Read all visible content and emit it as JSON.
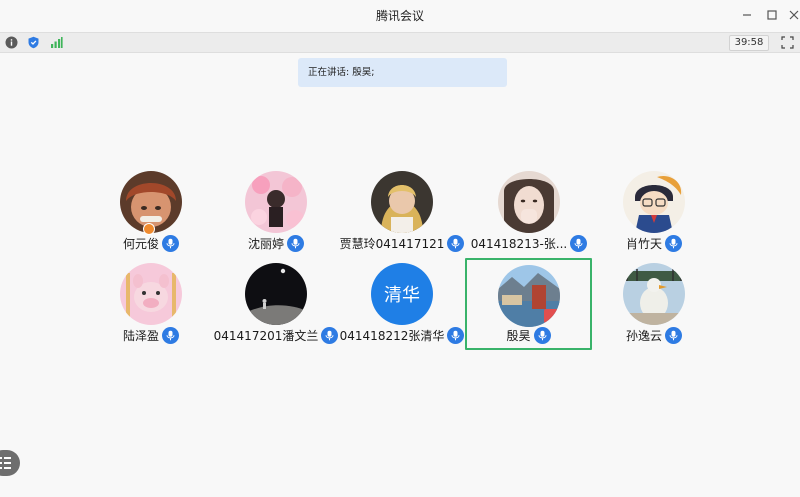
{
  "window": {
    "title": "腾讯会议"
  },
  "toolbar": {
    "timer": "39:58"
  },
  "speaking": {
    "text": "正在讲话: 殷昊;"
  },
  "participants": [
    {
      "name": "何元俊",
      "host": true,
      "active": false
    },
    {
      "name": "沈丽婷",
      "host": false,
      "active": false
    },
    {
      "name": "贾慧玲041417121",
      "host": false,
      "active": false
    },
    {
      "name": "041418213-张...",
      "host": false,
      "active": false
    },
    {
      "name": "肖竹天",
      "host": false,
      "active": false
    },
    {
      "name": "陆泽盈",
      "host": false,
      "active": false
    },
    {
      "name": "041417201潘文兰",
      "host": false,
      "active": false
    },
    {
      "name": "041418212张清华",
      "host": false,
      "active": false,
      "avatar_text": "清华"
    },
    {
      "name": "殷昊",
      "host": false,
      "active": true
    },
    {
      "name": "孙逸云",
      "host": false,
      "active": false
    }
  ],
  "colors": {
    "accent": "#2e7be3",
    "active_border": "#39b36a",
    "speaking_bg": "#dce9f9"
  },
  "icons": [
    "info-icon",
    "shield-icon",
    "signal-icon",
    "fullscreen-icon",
    "mic-icon",
    "menu-icon"
  ]
}
